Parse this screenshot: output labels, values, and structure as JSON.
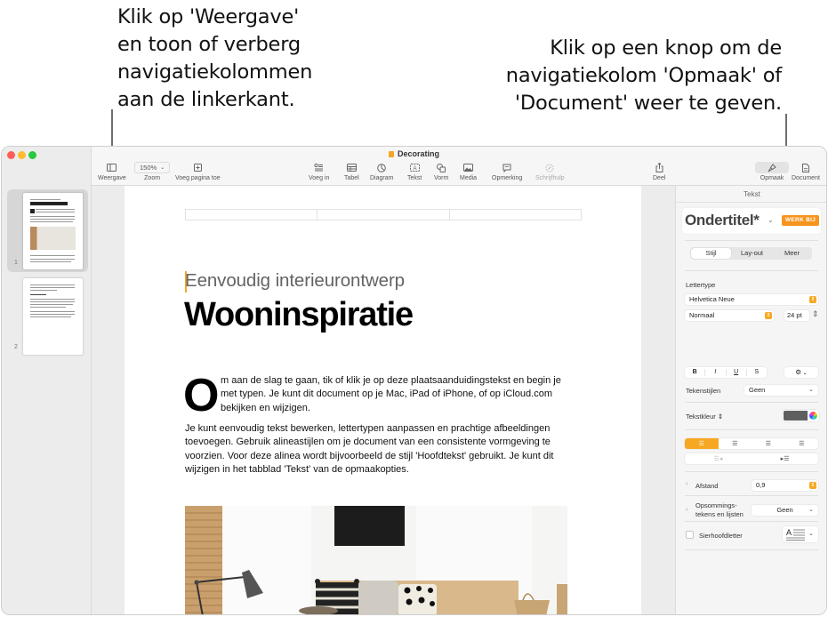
{
  "callouts": {
    "left": [
      "Klik op 'Weergave'",
      "en toon of verberg",
      "navigatiekolommen",
      "aan de linkerkant."
    ],
    "right": [
      "Klik op een knop om de",
      "navigatiekolom 'Opmaak' of",
      "'Document' weer te geven."
    ]
  },
  "window": {
    "title": "Decorating",
    "accent_color": "#f7a823"
  },
  "toolbar": {
    "view_label": "Weergave",
    "zoom_value": "150%",
    "zoom_label": "Zoom",
    "add_page_label": "Voeg pagina toe",
    "insert_label": "Voeg in",
    "table_label": "Tabel",
    "chart_label": "Diagram",
    "text_label": "Tekst",
    "shape_label": "Vorm",
    "media_label": "Media",
    "comment_label": "Opmerking",
    "writing_tools_label": "Schrijfhulp",
    "share_label": "Deel",
    "format_label": "Opmaak",
    "document_label": "Document"
  },
  "thumbnails": [
    {
      "page": "1",
      "selected": true
    },
    {
      "page": "2",
      "selected": false
    }
  ],
  "document": {
    "subtitle": "Eenvoudig interieurontwerp",
    "title": "Wooninspiratie",
    "dropcap": "O",
    "para1": "m aan de slag te gaan, tik of klik je op deze plaatsaanduidingstekst en begin je met typen. Je kunt dit document op je Mac, iPad of iPhone, of op iCloud.com bekijken en wijzigen.",
    "para2": "Je kunt eenvoudig tekst bewerken, lettertypen aanpassen en prachtige afbeeldingen toevoegen. Gebruik alineastijlen om je document van een consistente vormgeving te voorzien. Voor deze alinea wordt bijvoorbeeld de stijl 'Hoofdtekst' gebruikt. Je kunt dit wijzigen in het tabblad 'Tekst' van de opmaakopties."
  },
  "inspector": {
    "tab": "Tekst",
    "paragraph_style": "Ondertitel*",
    "update_button": "WERK BIJ",
    "segments": [
      "Stijl",
      "Lay-out",
      "Meer"
    ],
    "active_segment": "Stijl",
    "font_section_label": "Lettertype",
    "font_family": "Helvetica Neue",
    "font_style": "Normaal",
    "font_size": "24 pt",
    "bold": "B",
    "italic": "I",
    "underline": "U",
    "strikethrough": "S",
    "char_styles_label": "Tekenstijlen",
    "char_styles_value": "Geen",
    "text_color_label": "Tekstkleur",
    "text_color": "#5f5f5f",
    "alignment_selected": "left",
    "spacing_label": "Afstand",
    "spacing_value": "0,9",
    "bullets_label_1": "Opsommings-",
    "bullets_label_2": "tekens en lijsten",
    "bullets_value": "Geen",
    "dropcap_label": "Sierhoofdletter",
    "dropcap_checked": false
  }
}
